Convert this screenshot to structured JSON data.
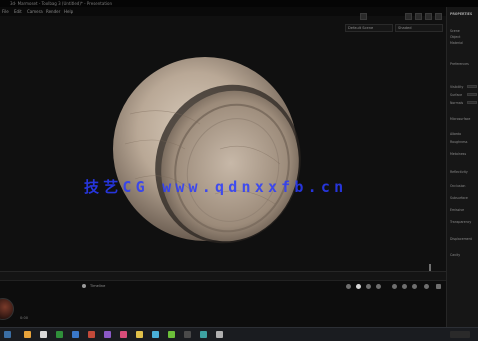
{
  "titlebar": {
    "title": "3d· Marmoset - Toolbag 3 (Untitled)* - Presentation"
  },
  "menu": {
    "items": [
      "File",
      "Edit",
      "Camera",
      "Render",
      "Help"
    ]
  },
  "viewport": {
    "camera_dropdown": "Default Scene",
    "display_dropdown": "Shaded",
    "watermark": "技艺CG  www.qdnxxfb.cn"
  },
  "right_panel": {
    "title": "PROPERTIES",
    "tabs": [
      "Scene",
      "Object",
      "Material"
    ],
    "items": [
      "Preferences",
      "Visibility",
      "Surface",
      "Normals",
      "Microsurface",
      "Albedo",
      "Roughness",
      "Metalness",
      "Reflectivity",
      "Occlusion",
      "Subsurface",
      "Emissive",
      "Transparency",
      "Displacement",
      "Cavity"
    ]
  },
  "timeline": {
    "label": "Timeline",
    "time": "0:00"
  },
  "colors": {
    "accent": "#2b3cff",
    "background": "#0b0b0b",
    "panel": "#161616"
  }
}
